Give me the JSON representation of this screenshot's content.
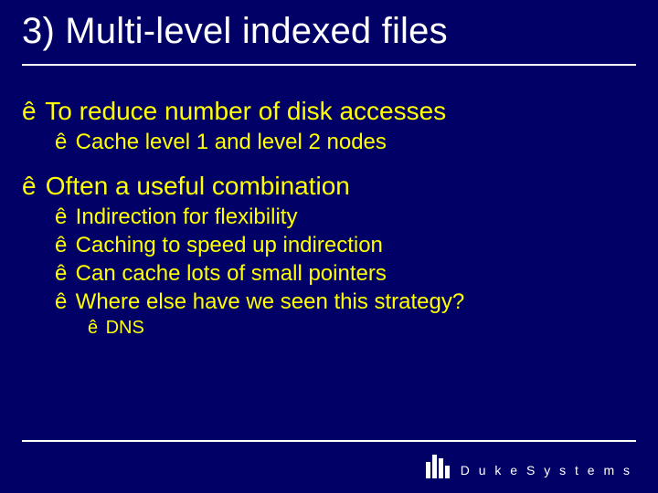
{
  "slide": {
    "title": "3) Multi-level indexed files",
    "bullet_mark": "ê",
    "bullets": [
      {
        "text": "To reduce number of disk accesses",
        "children": [
          {
            "text": "Cache level 1 and level 2 nodes",
            "children": []
          }
        ]
      },
      {
        "text": "Often a useful combination",
        "children": [
          {
            "text": "Indirection for flexibility",
            "children": []
          },
          {
            "text": "Caching to speed up indirection",
            "children": []
          },
          {
            "text": "Can cache lots of small pointers",
            "children": []
          },
          {
            "text": "Where else have we seen this strategy?",
            "children": [
              {
                "text": "DNS",
                "children": []
              }
            ]
          }
        ]
      }
    ]
  },
  "footer": {
    "brand": "D u k e   S y s t e m s"
  }
}
